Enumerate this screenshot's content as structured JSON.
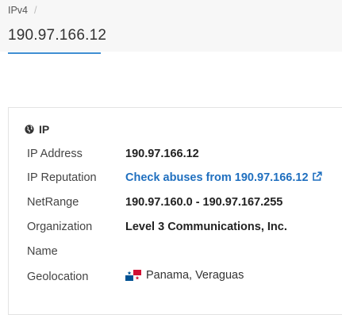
{
  "breadcrumb": {
    "item": "IPv4",
    "separator": "/"
  },
  "page_title": "190.97.166.12",
  "card": {
    "header": "IP",
    "rows": [
      {
        "label": "IP Address",
        "value": "190.97.166.12"
      },
      {
        "label": "IP Reputation",
        "value": "Check abuses from 190.97.166.12"
      },
      {
        "label": "NetRange",
        "value": "190.97.160.0 - 190.97.167.255"
      },
      {
        "label": "Organization",
        "value": "Level 3 Communications, Inc."
      },
      {
        "label": "Name",
        "value": ""
      },
      {
        "label": "Geolocation",
        "value": "Panama, Veraguas"
      }
    ]
  },
  "colors": {
    "accent": "#3f8fd2",
    "link": "#1f6fbf"
  },
  "icons": {
    "header": "globe-icon",
    "reputation": "external-link-icon",
    "geolocation": "panama-flag-icon"
  }
}
